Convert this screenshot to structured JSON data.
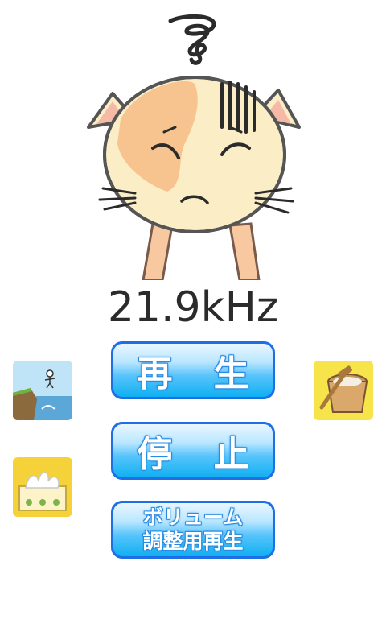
{
  "frequency": {
    "value": "21.9kHz"
  },
  "buttons": {
    "play": "再 生",
    "stop": "停 止",
    "volume_line1": "ボリューム",
    "volume_line2": "調整用再生"
  },
  "icons": {
    "illustration": "dizzy-cat-face",
    "app1": "cliff-jump-app-icon",
    "app2": "tissue-box-app-icon",
    "app3": "rice-mortar-app-icon"
  },
  "colors": {
    "button_border": "#1e6ee8",
    "button_fill_top": "#e9f7ff",
    "button_fill_bottom": "#0fb0f2",
    "text": "#2b2b2b"
  }
}
